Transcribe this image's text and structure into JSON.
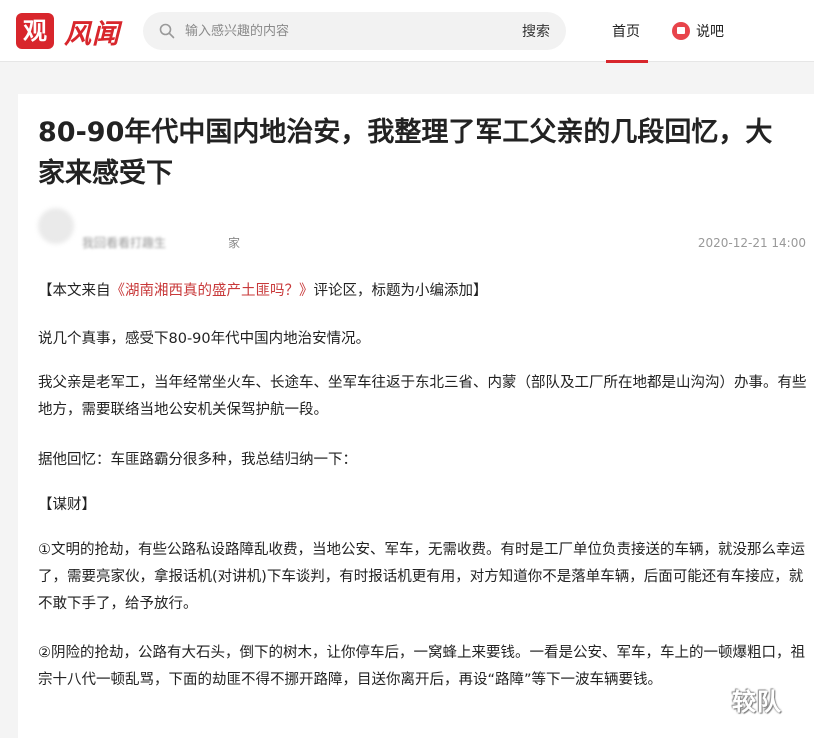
{
  "header": {
    "logo_icon_text": "观",
    "logo_text": "风闻",
    "search_placeholder": "输入感兴趣的内容",
    "search_button": "搜索",
    "nav_home": "首页",
    "nav_shuoba": "说吧"
  },
  "article": {
    "title": "80-90年代中国内地治安，我整理了军工父亲的几段回忆，大家来感受下",
    "author_name": "我回看看打趣生",
    "author_suffix": "家",
    "timestamp": "2020-12-21 14:00",
    "p1_prefix": "【本文来自",
    "p1_link": "《湖南湘西真的盛产土匪吗？》",
    "p1_suffix": "评论区，标题为小编添加】",
    "p2": "说几个真事，感受下80-90年代中国内地治安情况。",
    "p3": "我父亲是老军工，当年经常坐火车、长途车、坐军车往返于东北三省、内蒙（部队及工厂所在地都是山沟沟）办事。有些地方，需要联络当地公安机关保驾护航一段。",
    "p4": "据他回忆：车匪路霸分很多种，我总结归纳一下：",
    "p5": "【谋财】",
    "p6": "①文明的抢劫，有些公路私设路障乱收费，当地公安、军车，无需收费。有时是工厂单位负责接送的车辆，就没那么幸运了，需要亮家伙，拿报话机(对讲机)下车谈判，有时报话机更有用，对方知道你不是落单车辆，后面可能还有车接应，就不敢下手了，给予放行。",
    "p7": "②阴险的抢劫，公路有大石头，倒下的树木，让你停车后，一窝蜂上来要钱。一看是公安、军车，车上的一顿爆粗口，祖宗十八代一顿乱骂，下面的劫匪不得不挪开路障，目送你离开后，再设“路障”等下一波车辆要钱。"
  },
  "watermark": "较队",
  "colors": {
    "brand_red": "#d8262c",
    "link_red": "#c8393a"
  }
}
